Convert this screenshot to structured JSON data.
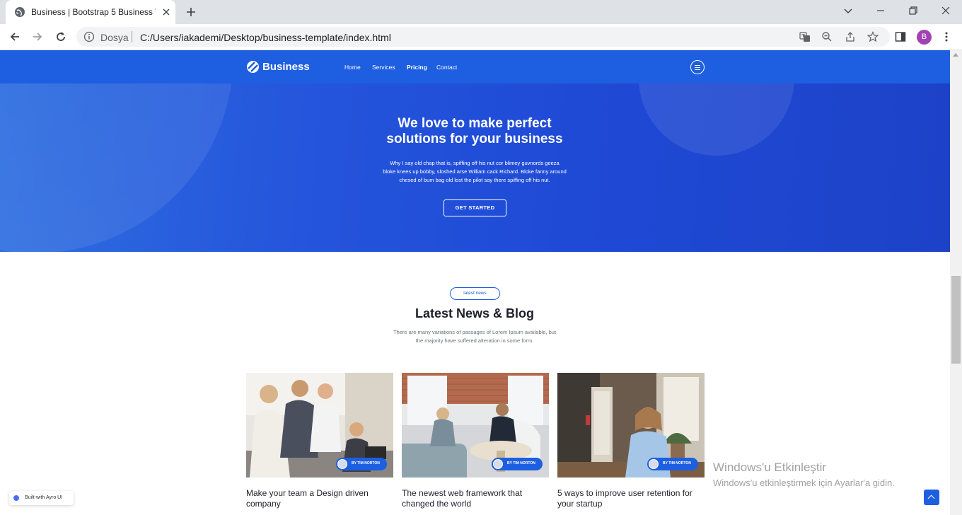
{
  "browser": {
    "tab_title": "Business | Bootstrap 5 Business Te",
    "favicon": "globe-icon",
    "address_scheme": "Dosya",
    "address_url": "C:/Users/iakademi/Desktop/business-template/index.html",
    "profile_initial": "B",
    "profile_color": "#a142b4"
  },
  "site": {
    "brand": "Business",
    "brand_color": "#1d5fe0",
    "menu": [
      "Home",
      "Services",
      "Pricing",
      "Contact"
    ],
    "active_menu": "Pricing"
  },
  "hero": {
    "title_line1": "We love to make perfect",
    "title_line2": "solutions for your business",
    "description_line1": "Why I say old chap that is, spiffing off his nut cor blimey guvnords geeza",
    "description_line2": "bloke knees up bobby, sloshed arse William cack Richard. Bloke fanny around",
    "description_line3": "chesed of bum bag old lost the pilot say there spiffing off his nut.",
    "cta": "GET STARTED"
  },
  "news": {
    "badge": "latest news",
    "title": "Latest News & Blog",
    "subtitle_line1": "There are many variations of passages of Lorem Ipsum available, but",
    "subtitle_line2": "the majority have suffered alteration in some form.",
    "cards": [
      {
        "author": "BY TIM NORTON",
        "title": "Make your team a Design driven company"
      },
      {
        "author": "BY TIM NORTON",
        "title": "The newest web framework that changed the world"
      },
      {
        "author": "BY TIM NORTON",
        "title": "5 ways to improve user retention for your startup"
      }
    ]
  },
  "badge": {
    "built_with": "Built-with Ayro UI"
  },
  "windows_watermark": {
    "title": "Windows'u Etkinleştir",
    "subtitle": "Windows'u etkinleştirmek için Ayarlar'a gidin."
  }
}
